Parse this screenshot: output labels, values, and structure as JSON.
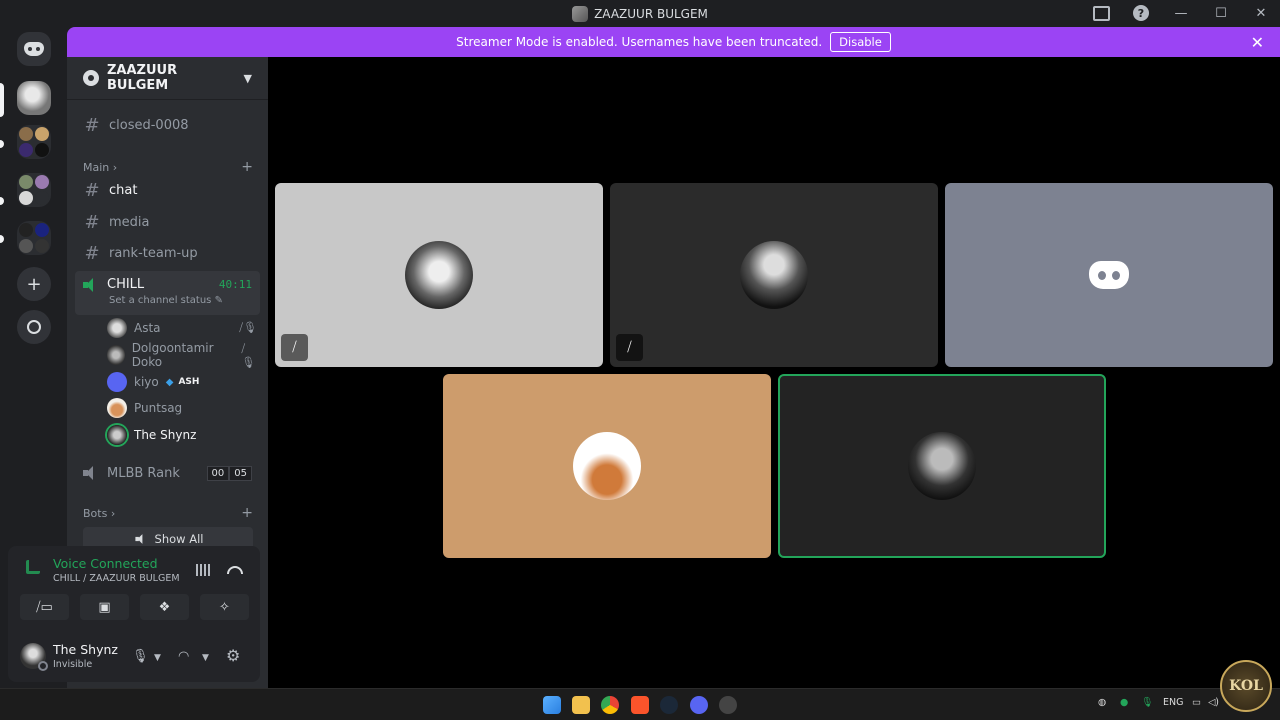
{
  "window": {
    "title": "ZAAZUUR BULGEM"
  },
  "banner": {
    "text": "Streamer Mode is enabled. Usernames have been truncated.",
    "button": "Disable"
  },
  "server": {
    "name": "ZAAZUUR BULGEM"
  },
  "channels": {
    "top": "closed-0008",
    "main_category": "Main",
    "text": [
      "chat",
      "media",
      "rank-team-up"
    ],
    "voice_active": {
      "name": "CHILL",
      "timer": "40:11",
      "status": "Set a channel status"
    },
    "members": [
      {
        "name": "Asta",
        "muted": true
      },
      {
        "name": "Dolgoontamir Doko",
        "muted": true
      },
      {
        "name": "kiyo",
        "tag": "ASH"
      },
      {
        "name": "Puntsag"
      },
      {
        "name": "The Shynz"
      }
    ],
    "voice2": {
      "name": "MLBB Rank",
      "count_a": "00",
      "count_b": "05"
    },
    "bots_category": "Bots",
    "show_all": "Show All"
  },
  "voice_panel": {
    "title": "Voice Connected",
    "subtitle": "CHILL / ZAAZUUR BULGEM"
  },
  "user": {
    "name": "The Shynz",
    "status": "Invisible"
  },
  "watermark": "KOL",
  "colors": {
    "accent": "#9b44f4",
    "voice_green": "#23a55a",
    "bg": "#2b2d31"
  }
}
